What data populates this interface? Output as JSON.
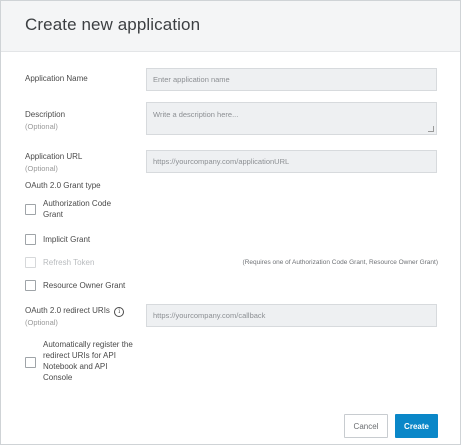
{
  "dialog": {
    "title": "Create new application"
  },
  "form": {
    "app_name": {
      "label": "Application Name",
      "placeholder": "Enter application name"
    },
    "description": {
      "label": "Description",
      "optional": "(Optional)",
      "placeholder": "Write a description here..."
    },
    "app_url": {
      "label": "Application URL",
      "optional": "(Optional)",
      "placeholder": "https://yourcompany.com/applicationURL"
    },
    "grant_type": {
      "label": "OAuth 2.0 Grant type",
      "options": [
        {
          "label": "Authorization Code Grant",
          "checked": false,
          "disabled": false
        },
        {
          "label": "Implicit Grant",
          "checked": false,
          "disabled": false
        },
        {
          "label": "Refresh Token",
          "checked": false,
          "disabled": true
        },
        {
          "label": "Resource Owner Grant",
          "checked": false,
          "disabled": false
        }
      ],
      "refresh_note": "(Requires one of Authorization Code Grant, Resource Owner Grant)"
    },
    "redirect": {
      "label": "OAuth 2.0 redirect URIs",
      "info_icon": "info-icon",
      "optional": "(Optional)",
      "placeholder": "https://yourcompany.com/callback"
    },
    "auto_register": {
      "label": "Automatically register the redirect URIs for API Notebook and API Console",
      "checked": false
    }
  },
  "actions": {
    "cancel_label": "Cancel",
    "create_label": "Create"
  },
  "colors": {
    "primary": "#0a87c8",
    "header_bg": "#f4f5f6",
    "field_bg": "#eef0f2"
  }
}
